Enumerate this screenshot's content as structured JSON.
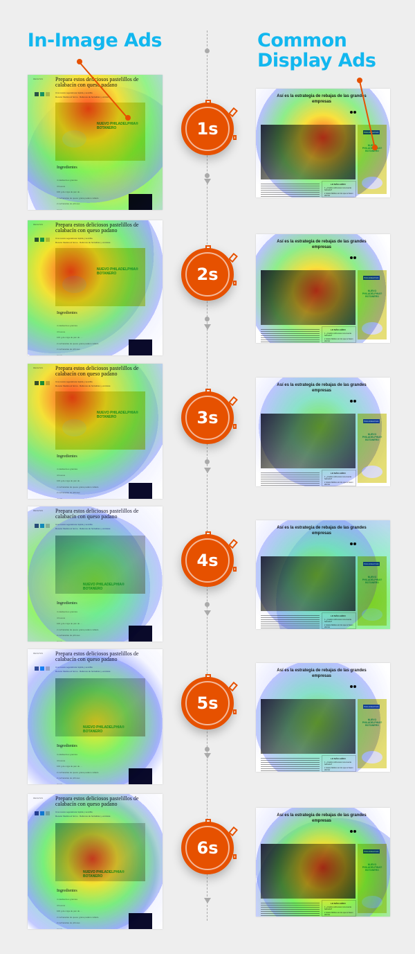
{
  "headers": {
    "left": "In-Image Ads",
    "right": "Common Display Ads"
  },
  "colors": {
    "accent": "#e65100",
    "heading": "#12b7ef",
    "background": "#eeeeee"
  },
  "rows": [
    {
      "time": "1s"
    },
    {
      "time": "2s"
    },
    {
      "time": "3s"
    },
    {
      "time": "4s"
    },
    {
      "time": "5s"
    },
    {
      "time": "6s"
    }
  ],
  "left_page": {
    "section": "RECETAS",
    "title": "Prepara estos deliciosos pastelillos de calabacín con queso padano",
    "bullets": [
      "Una receta vegetariana rápida y sencilla",
      "Receta: Medios al horno · Rellenos de hortalizas y verduras"
    ],
    "ad_text": "NUEVO PHILADELPHIA® BOTANERO",
    "ingredients_heading": "Ingredientes",
    "ingredients": [
      "4 calabacines grandes",
      "4 huevos",
      "100 g de miga de pan de ...",
      "2 cucharadas de queso grana padano rallado",
      "2 cucharadas de piñones",
      "Aceite",
      "Sal y pimienta"
    ]
  },
  "right_page": {
    "title": "Así es la estrategia de rebajas de las grandes empresas",
    "ad_brand": "PHILADELPHIA",
    "ad_text": "NUEVO PHILADELPHIA® BOTANERO",
    "most_read_heading": "LO MÁS LEÍDO",
    "most_read": [
      {
        "n": "1.",
        "text": "¿Cuánto cobra tener una cuenta bancaria?"
      },
      {
        "n": "2.",
        "text": "Estos hábitos son los que te hacen ahorrar"
      }
    ]
  }
}
